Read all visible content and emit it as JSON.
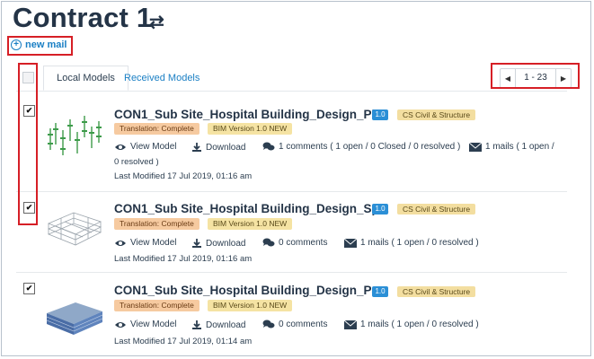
{
  "page": {
    "title": "Contract 1",
    "new_mail": "new mail"
  },
  "tabs": {
    "local": "Local Models",
    "received": "Received Models"
  },
  "pager": {
    "range": "1 - 23"
  },
  "models": [
    {
      "name": "CON1_Sub Site_Hospital Building_Design_Pl...",
      "version": "1.0",
      "discipline": "CS Civil & Structure",
      "translation": "Translation: Complete",
      "bim": "BIM Version 1.0 NEW",
      "view": "View Model",
      "download": "Download",
      "comments": "1 comments ( 1 open / 0 Closed / 0 resolved )",
      "mails": "1 mails ( 1 open /",
      "mails_cont": "0 resolved )",
      "modified": "Last Modified 17 Jul 2019, 01:16 am",
      "checked": true
    },
    {
      "name": "CON1_Sub Site_Hospital Building_Design_Sp...",
      "version": "1.0",
      "discipline": "CS Civil & Structure",
      "translation": "Translation: Complete",
      "bim": "BIM Version 1.0 NEW",
      "view": "View Model",
      "download": "Download",
      "comments": "0 comments",
      "mails": "1 mails ( 1 open / 0 resolved )",
      "modified": "Last Modified 17 Jul 2019, 01:16 am",
      "checked": true
    },
    {
      "name": "CON1_Sub Site_Hospital Building_Design_Pa...",
      "version": "1.0",
      "discipline": "CS Civil & Structure",
      "translation": "Translation: Complete",
      "bim": "BIM Version 1.0 NEW",
      "view": "View Model",
      "download": "Download",
      "comments": "0 comments",
      "mails": "1 mails ( 1 open / 0 resolved )",
      "modified": "Last Modified 17 Jul 2019, 01:14 am",
      "checked": true
    }
  ],
  "icons": {
    "swap": "swap-arrows-icon",
    "new_mail": "plus-circle-icon",
    "view": "eye-icon",
    "download": "download-icon",
    "comments": "comments-icon",
    "mails": "envelope-icon",
    "check": "checkmark-icon"
  },
  "colors": {
    "accent": "#1a7fc4",
    "highlight": "#d61f26",
    "version_badge": "#2b8fd6",
    "translation_tag": "#f6caa0",
    "bim_tag": "#f5e3a3"
  }
}
